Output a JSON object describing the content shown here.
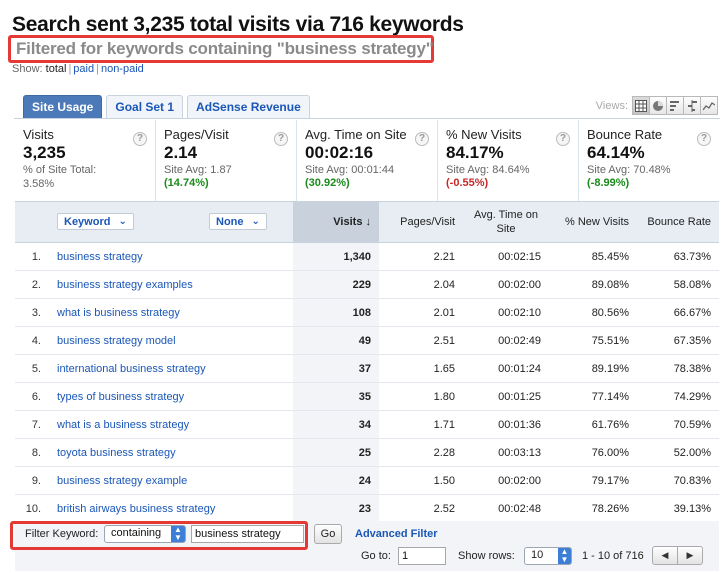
{
  "header": {
    "title": "Search sent 3,235 total visits via 716 keywords",
    "subtitle": "Filtered for keywords containing \"business strategy\"",
    "show_label": "Show:",
    "show_options": [
      "total",
      "paid",
      "non-paid"
    ]
  },
  "tabs": [
    {
      "label": "Site Usage",
      "active": true
    },
    {
      "label": "Goal Set 1",
      "active": false
    },
    {
      "label": "AdSense Revenue",
      "active": false
    }
  ],
  "views": {
    "label": "Views:",
    "icons": [
      "table-view-icon",
      "pie-view-icon",
      "performance-view-icon",
      "comparison-view-icon",
      "trend-view-icon"
    ]
  },
  "summary": [
    {
      "label": "Visits",
      "value": "3,235",
      "sub1": "% of Site Total:",
      "sub2": "3.58%",
      "pct": "",
      "pct_class": ""
    },
    {
      "label": "Pages/Visit",
      "value": "2.14",
      "sub1": "Site Avg: 1.87",
      "sub2": "",
      "pct": "(14.74%)",
      "pct_class": "pos"
    },
    {
      "label": "Avg. Time on Site",
      "value": "00:02:16",
      "sub1": "Site Avg: 00:01:44",
      "sub2": "",
      "pct": "(30.92%)",
      "pct_class": "pos"
    },
    {
      "label": "% New Visits",
      "value": "84.17%",
      "sub1": "Site Avg: 84.64%",
      "sub2": "",
      "pct": "(-0.55%)",
      "pct_class": "neg"
    },
    {
      "label": "Bounce Rate",
      "value": "64.14%",
      "sub1": "Site Avg: 70.48%",
      "sub2": "",
      "pct": "(-8.99%)",
      "pct_class": "pos"
    }
  ],
  "table": {
    "dimension_label": "Keyword",
    "secondary_label": "None",
    "columns": [
      "Visits",
      "Pages/Visit",
      "Avg. Time on Site",
      "% New Visits",
      "Bounce Rate"
    ],
    "rows": [
      {
        "rank": "1.",
        "keyword": "business strategy",
        "visits": "1,340",
        "ppv": "2.21",
        "time": "00:02:15",
        "new": "85.45%",
        "bounce": "63.73%"
      },
      {
        "rank": "2.",
        "keyword": "business strategy examples",
        "visits": "229",
        "ppv": "2.04",
        "time": "00:02:00",
        "new": "89.08%",
        "bounce": "58.08%"
      },
      {
        "rank": "3.",
        "keyword": "what is business strategy",
        "visits": "108",
        "ppv": "2.01",
        "time": "00:02:10",
        "new": "80.56%",
        "bounce": "66.67%"
      },
      {
        "rank": "4.",
        "keyword": "business strategy model",
        "visits": "49",
        "ppv": "2.51",
        "time": "00:02:49",
        "new": "75.51%",
        "bounce": "67.35%"
      },
      {
        "rank": "5.",
        "keyword": "international business strategy",
        "visits": "37",
        "ppv": "1.65",
        "time": "00:01:24",
        "new": "89.19%",
        "bounce": "78.38%"
      },
      {
        "rank": "6.",
        "keyword": "types of business strategy",
        "visits": "35",
        "ppv": "1.80",
        "time": "00:01:25",
        "new": "77.14%",
        "bounce": "74.29%"
      },
      {
        "rank": "7.",
        "keyword": "what is a business strategy",
        "visits": "34",
        "ppv": "1.71",
        "time": "00:01:36",
        "new": "61.76%",
        "bounce": "70.59%"
      },
      {
        "rank": "8.",
        "keyword": "toyota business strategy",
        "visits": "25",
        "ppv": "2.28",
        "time": "00:03:13",
        "new": "76.00%",
        "bounce": "52.00%"
      },
      {
        "rank": "9.",
        "keyword": "business strategy example",
        "visits": "24",
        "ppv": "1.50",
        "time": "00:02:00",
        "new": "79.17%",
        "bounce": "70.83%"
      },
      {
        "rank": "10.",
        "keyword": "british airways business strategy",
        "visits": "23",
        "ppv": "2.52",
        "time": "00:02:48",
        "new": "78.26%",
        "bounce": "39.13%"
      }
    ]
  },
  "filter": {
    "label": "Filter Keyword:",
    "mode": "containing",
    "value": "business strategy",
    "go_label": "Go",
    "advanced_label": "Advanced Filter"
  },
  "pagination": {
    "goto_label": "Go to:",
    "goto_value": "1",
    "rows_label": "Show rows:",
    "rows_value": "10",
    "range": "1 - 10 of 716",
    "prev": "◀",
    "next": "▶"
  }
}
